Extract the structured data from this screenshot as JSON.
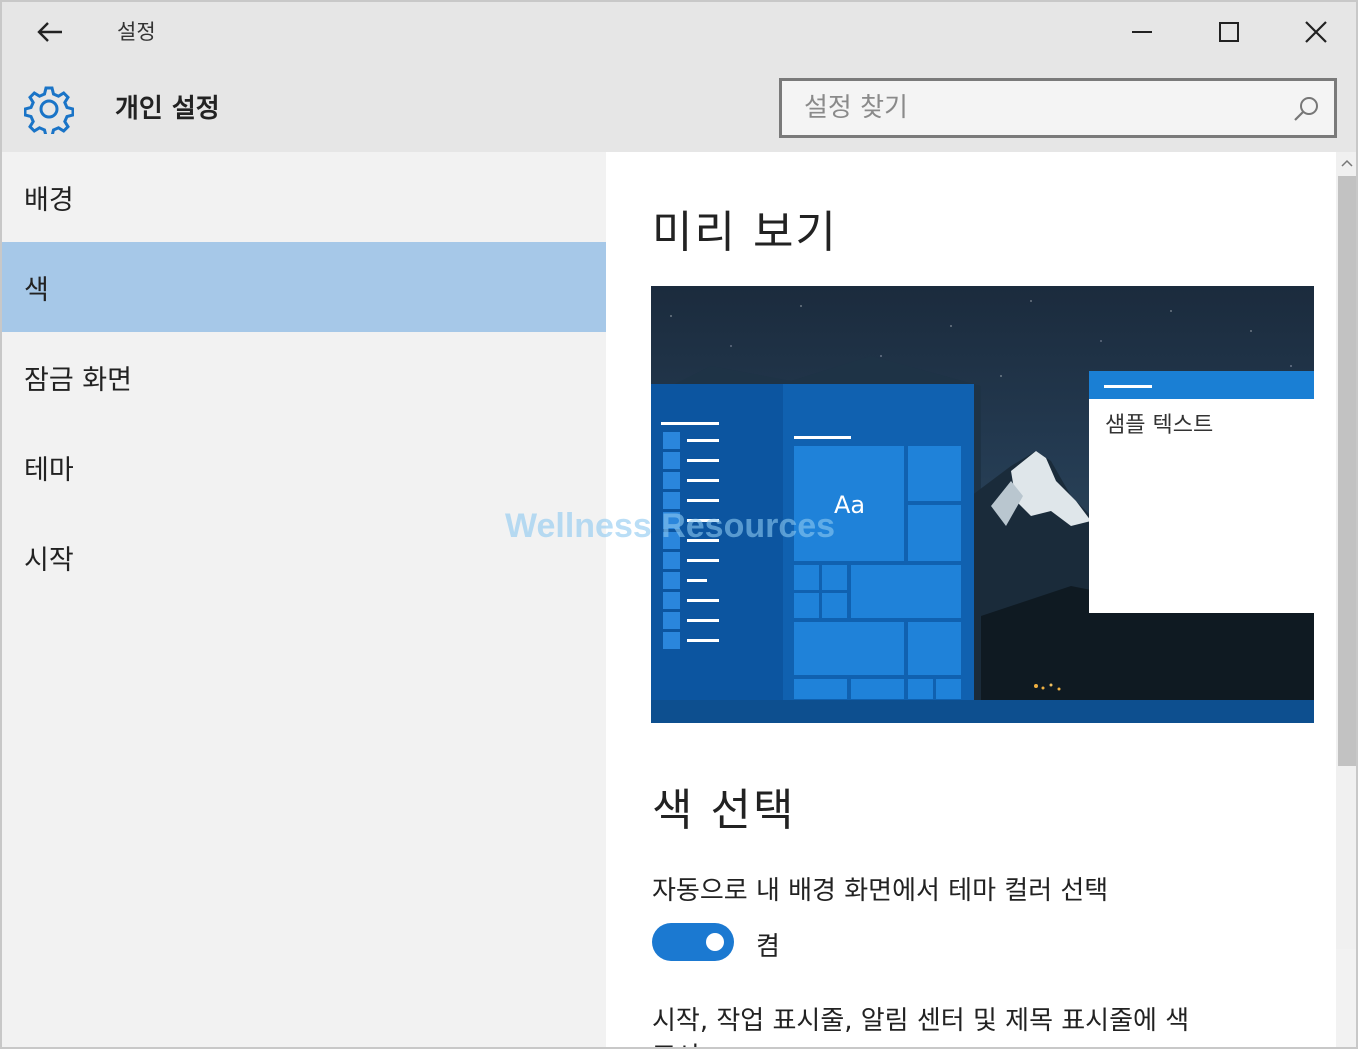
{
  "window": {
    "title": "설정"
  },
  "header": {
    "title": "개인 설정",
    "search_placeholder": "설정 찾기"
  },
  "sidebar": {
    "items": [
      {
        "label": "배경"
      },
      {
        "label": "색"
      },
      {
        "label": "잠금 화면"
      },
      {
        "label": "테마"
      },
      {
        "label": "시작"
      }
    ],
    "active_index": 1
  },
  "content": {
    "preview_title": "미리 보기",
    "preview_sample_text": "샘플 텍스트",
    "preview_tile_text": "Aa",
    "color_section_title": "색 선택",
    "auto_color_label": "자동으로 내 배경 화면에서 테마 컬러 선택",
    "auto_color_state": "켬",
    "next_setting_label": "시작, 작업 표시줄, 알림 센터 및 제목 표시줄에 색",
    "next_setting_label_cont": "표시"
  },
  "watermark": "Wellness Resources",
  "colors": {
    "accent": "#1b79d1",
    "selected_nav": "#a6c8e8",
    "chrome": "#e6e6e6"
  }
}
